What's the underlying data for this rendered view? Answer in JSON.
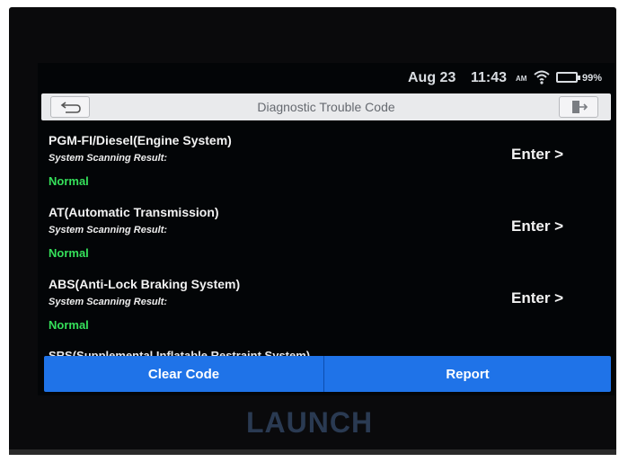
{
  "status_bar": {
    "date": "Aug 23",
    "time": "11:43",
    "ampm": "AM",
    "battery_pct": "99%"
  },
  "header": {
    "title": "Diagnostic Trouble Code"
  },
  "systems": [
    {
      "name": "PGM-FI/Diesel(Engine System)",
      "sub": "System Scanning Result:",
      "result": "Normal",
      "action": "Enter >"
    },
    {
      "name": "AT(Automatic Transmission)",
      "sub": "System Scanning Result:",
      "result": "Normal",
      "action": "Enter >"
    },
    {
      "name": "ABS(Anti-Lock Braking System)",
      "sub": "System Scanning Result:",
      "result": "Normal",
      "action": "Enter >"
    }
  ],
  "partial_row": {
    "name": "SRS(Supplemental Inflatable Restraint System)"
  },
  "footer": {
    "clear_code": "Clear Code",
    "report": "Report"
  },
  "device": {
    "brand": "LAUNCH"
  },
  "colors": {
    "accent": "#1f73e8",
    "normal": "#35e05a"
  }
}
